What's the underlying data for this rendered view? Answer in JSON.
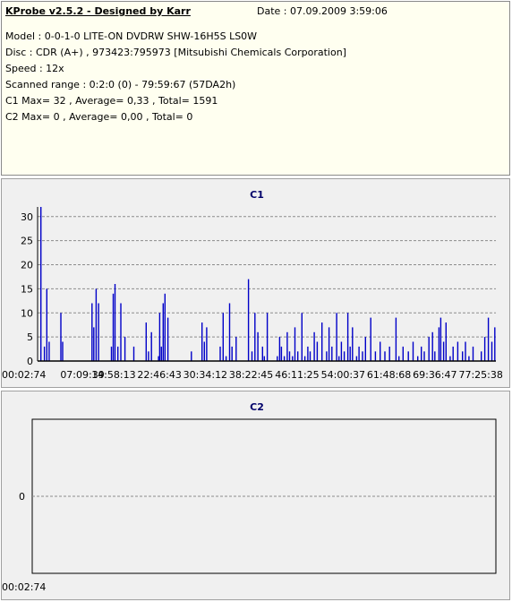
{
  "info": {
    "title": "KProbe v2.5.2 - Designed by Karr",
    "date": "Date : 07.09.2009 3:59:06",
    "lines": [
      "Model : 0-0-1-0 LITE-ON DVDRW SHW-16H5S  LS0W",
      "Disc : CDR (A+) , 973423:795973 [Mitsubishi Chemicals Corporation]",
      "Speed : 12x",
      "Scanned range : 0:2:0 (0) - 79:59:67 (57DA2h)",
      "C1 Max= 32 , Average= 0,33 , Total= 1591",
      "C2 Max= 0 , Average= 0,00 , Total= 0"
    ]
  },
  "colors": {
    "bars": "#0000c8",
    "axis": "#000000",
    "grid": "#8c8c8c",
    "panel_bg": "#f0f0f0",
    "info_bg": "#fffff0",
    "title": "#00006a"
  },
  "chart_data": [
    {
      "type": "bar",
      "title": "C1",
      "x_unit": "minutes",
      "xlim": [
        2.045,
        79.99
      ],
      "ylim": [
        0,
        30
      ],
      "ytick_values": [
        0,
        5,
        10,
        15,
        20,
        25,
        30
      ],
      "ytick_labels": [
        "0",
        "5",
        "10",
        "15",
        "20",
        "25",
        "30"
      ],
      "xtick_values": [
        2.045,
        9.66,
        14.97,
        22.77,
        30.57,
        38.37,
        46.19,
        54.01,
        61.81,
        69.61,
        77.43
      ],
      "xtick_labels": [
        "00:02:74",
        "07:09:39",
        "14:58:13",
        "22:46:43",
        "30:34:12",
        "38:22:45",
        "46:11:25",
        "54:00:37",
        "61:48:68",
        "69:36:47",
        "77:25:38"
      ],
      "grid": "horizontal dashed",
      "x": [
        2.5,
        3.1,
        3.5,
        3.9,
        5.9,
        6.2,
        11.2,
        11.5,
        11.9,
        12.3,
        14.5,
        14.8,
        15.1,
        15.6,
        16.1,
        16.8,
        18.3,
        20.4,
        20.8,
        21.3,
        22.5,
        22.7,
        23.0,
        23.3,
        23.6,
        24.1,
        28.1,
        29.9,
        30.3,
        30.7,
        33.0,
        33.5,
        34.0,
        34.6,
        35.0,
        35.7,
        37.8,
        38.4,
        38.9,
        39.4,
        40.2,
        40.5,
        41.0,
        42.7,
        43.1,
        43.4,
        43.9,
        44.4,
        44.8,
        45.3,
        45.7,
        46.2,
        46.9,
        47.4,
        47.9,
        48.3,
        49.0,
        49.5,
        50.3,
        51.1,
        51.5,
        52.0,
        52.8,
        53.2,
        53.6,
        54.1,
        54.7,
        55.1,
        55.5,
        56.2,
        56.6,
        57.2,
        57.7,
        58.6,
        59.4,
        60.2,
        61.0,
        61.8,
        62.9,
        63.4,
        64.1,
        65.0,
        65.8,
        66.6,
        67.2,
        67.7,
        68.5,
        69.1,
        69.5,
        70.2,
        70.5,
        71.0,
        71.4,
        72.1,
        72.6,
        73.4,
        74.2,
        74.7,
        75.3,
        76.0,
        77.4,
        78.0,
        78.6,
        79.2,
        79.7
      ],
      "values": [
        32,
        3,
        15,
        4,
        10,
        4,
        12,
        7,
        15,
        12,
        3,
        14,
        16,
        3,
        12,
        5,
        3,
        8,
        2,
        6,
        1,
        10,
        3,
        12,
        14,
        9,
        2,
        8,
        4,
        7,
        3,
        10,
        1,
        12,
        3,
        5,
        17,
        2,
        10,
        6,
        3,
        1,
        10,
        1,
        5,
        3,
        1,
        6,
        2,
        1,
        7,
        2,
        10,
        1,
        3,
        2,
        6,
        4,
        8,
        2,
        7,
        3,
        10,
        1,
        4,
        2,
        10,
        3,
        7,
        1,
        3,
        2,
        5,
        9,
        2,
        4,
        2,
        3,
        9,
        1,
        3,
        2,
        4,
        1,
        3,
        2,
        5,
        6,
        2,
        7,
        9,
        4,
        8,
        1,
        3,
        4,
        2,
        4,
        1,
        3,
        2,
        5,
        9,
        4,
        7
      ]
    },
    {
      "type": "bar",
      "title": "C2",
      "xtick_labels": [
        "00:02:74"
      ],
      "ytick_labels": [
        "0"
      ],
      "values": []
    }
  ]
}
